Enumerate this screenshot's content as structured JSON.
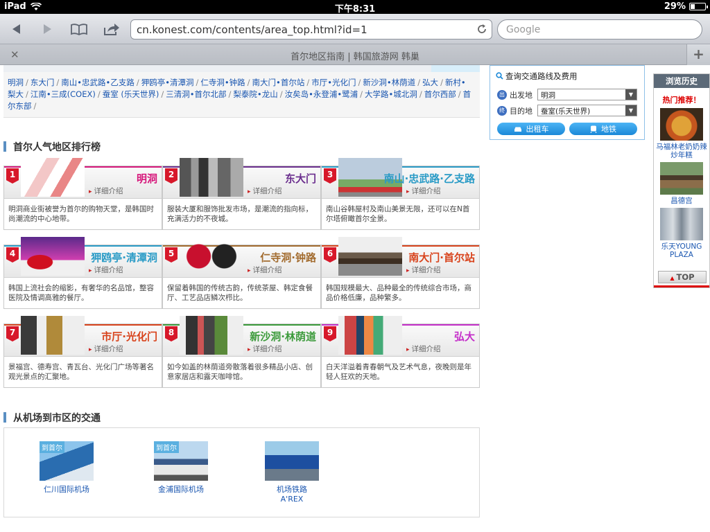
{
  "status": {
    "device": "iPad",
    "time": "下午8:31",
    "battery": "29%",
    "battery_level": 0.29
  },
  "browser": {
    "url": "cn.konest.com/contents/area_top.html?id=1",
    "search_placeholder": "Google",
    "tab_title": "首尔地区指南 | 韩国旅游网 韩巢",
    "new_tab": "+"
  },
  "districts": [
    "明洞",
    "东大门",
    "南山•忠武路•乙支路",
    "狎鸥亭•清潭洞",
    "仁寺洞•钟路",
    "南大门•首尔站",
    "市厅•光化门",
    "新沙洞•林荫道",
    "弘大",
    "新村•梨大",
    "江南•三成(COEX)",
    "蚕室 (乐天世界)",
    "三清洞•首尔北部",
    "梨泰院•龙山",
    "汝矣岛•永登浦•鹭浦",
    "大学路•城北洞",
    "首尔西部",
    "首尔东部"
  ],
  "ranking": {
    "title": "首尔人气地区排行榜",
    "detail_label": "详细介绍",
    "cards": [
      {
        "num": "1",
        "name": "明洞",
        "color": "#d6177b",
        "desc": "明洞商业街被誉为首尔的购物天堂，是韩国时尚潮流的中心地带。"
      },
      {
        "num": "2",
        "name": "东大门",
        "color": "#6b2f8e",
        "desc": "服装大厦和服饰批发市场，是潮流的指向标，充满活力的不夜城。"
      },
      {
        "num": "3",
        "name": "南山·忠武路·乙支路",
        "color": "#2a9bc6",
        "desc": "南山谷韩屋村及南山美景无限，还可以在N首尔塔俯瞰首尔全景。"
      },
      {
        "num": "4",
        "name": "狎鸥亭·清潭洞",
        "color": "#2a9bc6",
        "desc": "韩国上流社会的缩影，有奢华的名品馆，整容医院及情调高雅的餐厅。"
      },
      {
        "num": "5",
        "name": "仁寺洞·钟路",
        "color": "#a26b2e",
        "desc": "保留着韩国的传统古韵，传统茶屋、韩定食餐厅、工艺品店鳞次栉比。"
      },
      {
        "num": "6",
        "name": "南大门·首尔站",
        "color": "#d8431c",
        "desc": "韩国规模最大、品种最全的传统综合市场，商品价格低廉，品种繁多。"
      },
      {
        "num": "7",
        "name": "市厅·光化门",
        "color": "#d8431c",
        "desc": "景福宫、德寿宫、青瓦台、光化门广场等著名观光景点的汇聚地。"
      },
      {
        "num": "8",
        "name": "新沙洞·林荫道",
        "color": "#3b9a3a",
        "desc": "如今如盖的林荫道旁散落着很多精品小店、创意家居店和露天咖啡馆。"
      },
      {
        "num": "9",
        "name": "弘大",
        "color": "#c42fc9",
        "desc": "白天洋溢着青春朝气及艺术气息，夜晚则是年轻人狂欢的天地。"
      }
    ]
  },
  "transport": {
    "title": "从机场到市区的交通",
    "items": [
      {
        "tag": "到首尔",
        "label": "仁川国际机场"
      },
      {
        "tag": "到首尔",
        "label": "金浦国际机场"
      },
      {
        "tag": "",
        "label": "机场铁路\nA'REX"
      }
    ]
  },
  "route": {
    "title": "查询交通路线及费用",
    "from_label": "出发地",
    "from_value": "明洞",
    "to_label": "目的地",
    "to_value": "蚕室(乐天世界)",
    "from_badge": "出",
    "to_badge": "终",
    "taxi_btn": "出租车",
    "subway_btn": "地铁"
  },
  "history": {
    "title": "浏览历史",
    "hot": "热门推荐！",
    "items": [
      "马福林老奶奶辣炒年糕",
      "昌德宫",
      "乐天YOUNG PLAZA"
    ],
    "top_btn": "TOP"
  }
}
